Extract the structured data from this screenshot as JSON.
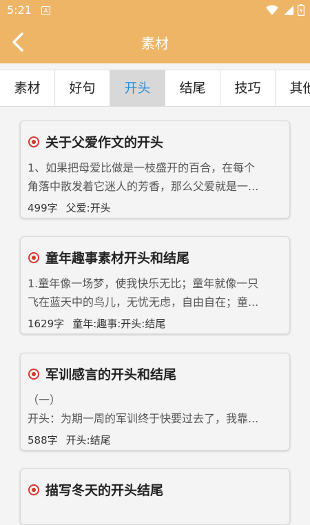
{
  "status": {
    "time": "5:21",
    "notif_glyph": "A"
  },
  "appbar": {
    "title": "素材",
    "back_icon": "chevron-left-icon"
  },
  "tabs": [
    {
      "label": "素材"
    },
    {
      "label": "好句"
    },
    {
      "label": "开头",
      "active": true
    },
    {
      "label": "结尾"
    },
    {
      "label": "技巧"
    },
    {
      "label": "其他"
    }
  ],
  "accent": "#efb567",
  "active_tab_color": "#2e8fd9",
  "bullet_color": "#d9342b",
  "cards": [
    {
      "title": "关于父爱作文的开头",
      "lines": [
        "1、如果把母爱比做是一枝盛开的百合，在每个",
        "角落中散发着它迷人的芳香，那么父爱就是一..."
      ],
      "count": "499字",
      "tags": "父爱:开头"
    },
    {
      "title": "童年趣事素材开头和结尾",
      "lines": [
        "1.童年像一场梦，使我快乐无比；童年就像一只",
        "飞在蓝天中的鸟儿，无忧无虑，自由自在；童..."
      ],
      "count": "1629字",
      "tags": "童年:趣事:开头:结尾"
    },
    {
      "title": "军训感言的开头和结尾",
      "lines": [
        "（一）",
        "开头：为期一周的军训终于快要过去了，我靠..."
      ],
      "count": "588字",
      "tags": "开头:结尾"
    },
    {
      "title": "描写冬天的开头结尾",
      "lines": [],
      "count": "",
      "tags": ""
    }
  ]
}
